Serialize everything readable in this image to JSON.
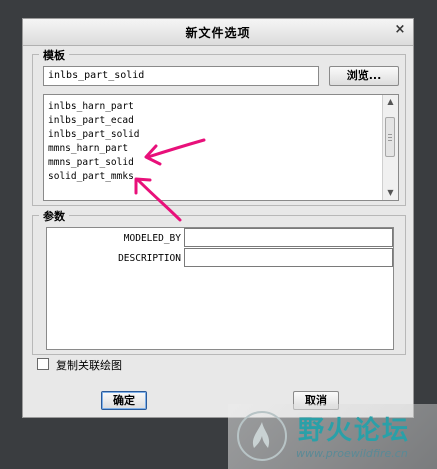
{
  "dialog": {
    "title": "新文件选项",
    "close_symbol": "×"
  },
  "template": {
    "label": "模板",
    "current_value": "inlbs_part_solid",
    "browse_label": "浏览...",
    "items": [
      "inlbs_harn_part",
      "inlbs_part_ecad",
      "inlbs_part_solid",
      "mmns_harn_part",
      "mmns_part_solid",
      "solid_part_mmks"
    ]
  },
  "parameters": {
    "label": "参数",
    "rows": [
      {
        "name": "MODELED_BY",
        "value": ""
      },
      {
        "name": "DESCRIPTION",
        "value": ""
      }
    ]
  },
  "copy_drawing": {
    "label": "复制关联绘图",
    "checked": false
  },
  "buttons": {
    "ok": "确定",
    "cancel": "取消"
  },
  "annotations": {
    "arrow_color": "#e8107a"
  },
  "watermark": {
    "text": "野火论坛",
    "url": "www.proewildfire.cn"
  }
}
